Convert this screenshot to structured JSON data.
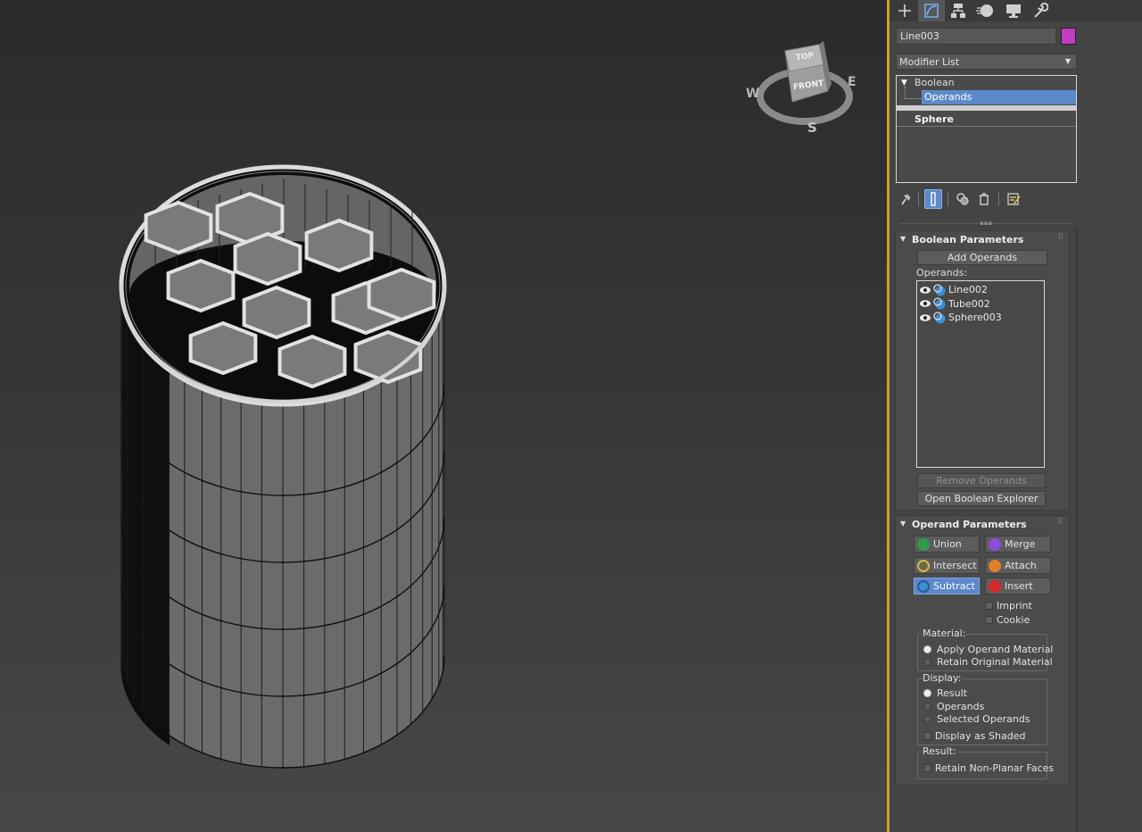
{
  "viewcube": {
    "top_label": "TOP",
    "front_label": "FRONT",
    "compass": {
      "west": "W",
      "east": "E",
      "south": "S"
    }
  },
  "tabs": [
    {
      "name": "create-tab",
      "icon": "plus-icon"
    },
    {
      "name": "modify-tab",
      "icon": "modify-icon",
      "active": true
    },
    {
      "name": "hierarchy-tab",
      "icon": "hierarchy-icon"
    },
    {
      "name": "motion-tab",
      "icon": "motion-icon"
    },
    {
      "name": "display-tab",
      "icon": "display-icon"
    },
    {
      "name": "utilities-tab",
      "icon": "wrench-icon"
    }
  ],
  "object_name": "Line003",
  "object_color": "#c23cc2",
  "modifier_list": {
    "label": "Modifier List"
  },
  "stack": {
    "boolean": "Boolean",
    "operands": "Operands",
    "sphere": "Sphere"
  },
  "boolean_parameters": {
    "title": "Boolean Parameters",
    "add_operands": "Add Operands",
    "operands_label": "Operands:",
    "operands": [
      "Line002",
      "Tube002",
      "Sphere003"
    ],
    "remove_operands": "Remove Operands",
    "open_explorer": "Open Boolean Explorer"
  },
  "operand_parameters": {
    "title": "Operand Parameters",
    "union": "Union",
    "merge": "Merge",
    "intersect": "Intersect",
    "attach": "Attach",
    "subtract": "Subtract",
    "insert": "Insert",
    "imprint": "Imprint",
    "cookie": "Cookie",
    "material_label": "Material:",
    "apply_material": "Apply Operand Material",
    "retain_material": "Retain Original Material",
    "display_label": "Display:",
    "display_result": "Result",
    "display_operands": "Operands",
    "display_selected": "Selected Operands",
    "display_shaded": "Display as Shaded",
    "result_label": "Result:",
    "retain_nonplanar": "Retain Non-Planar Faces"
  },
  "colors": {
    "accent": "#5d88c9",
    "viewport_border": "#c9a227",
    "union": "#2e9c4a",
    "merge": "#8a4fd8",
    "intersect": "#d4b84a",
    "attach": "#e0812a",
    "subtract": "#3a8fd8",
    "insert": "#d42a2a"
  }
}
